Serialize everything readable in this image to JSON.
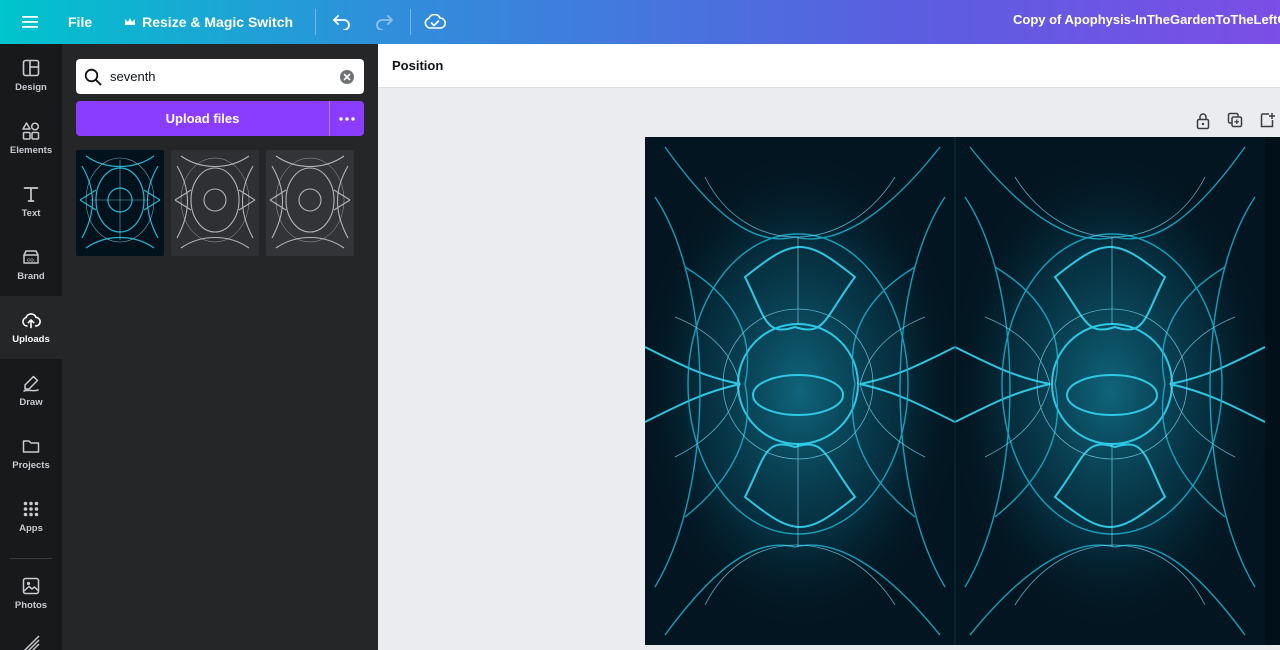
{
  "topbar": {
    "file_label": "File",
    "resize_label": "Resize & Magic Switch",
    "doc_title": "Copy of Apophysis-InTheGardenToTheLeftOf"
  },
  "rail": {
    "items": [
      {
        "label": "Design",
        "icon": "design-icon"
      },
      {
        "label": "Elements",
        "icon": "elements-icon"
      },
      {
        "label": "Text",
        "icon": "text-icon"
      },
      {
        "label": "Brand",
        "icon": "brand-icon"
      },
      {
        "label": "Uploads",
        "icon": "upload-cloud-icon"
      },
      {
        "label": "Draw",
        "icon": "draw-icon"
      },
      {
        "label": "Projects",
        "icon": "folder-icon"
      },
      {
        "label": "Apps",
        "icon": "apps-grid-icon"
      },
      {
        "label": "Photos",
        "icon": "photo-icon"
      }
    ],
    "active": "Uploads"
  },
  "panel": {
    "search_value": "seventh",
    "upload_label": "Upload files",
    "thumbnails": [
      {
        "name": "thumbnail-cyan-fractal",
        "tone": "cyan"
      },
      {
        "name": "thumbnail-grey-fractal-1",
        "tone": "grey"
      },
      {
        "name": "thumbnail-grey-fractal-2",
        "tone": "grey"
      }
    ]
  },
  "editor": {
    "toolbar_position_label": "Position"
  },
  "colors": {
    "accent_purple": "#8b3dff",
    "rail_bg": "#18191b",
    "panel_bg": "#252627",
    "canvas_bg": "#ebecf0",
    "artwork_cyan": "#27c9e8"
  }
}
